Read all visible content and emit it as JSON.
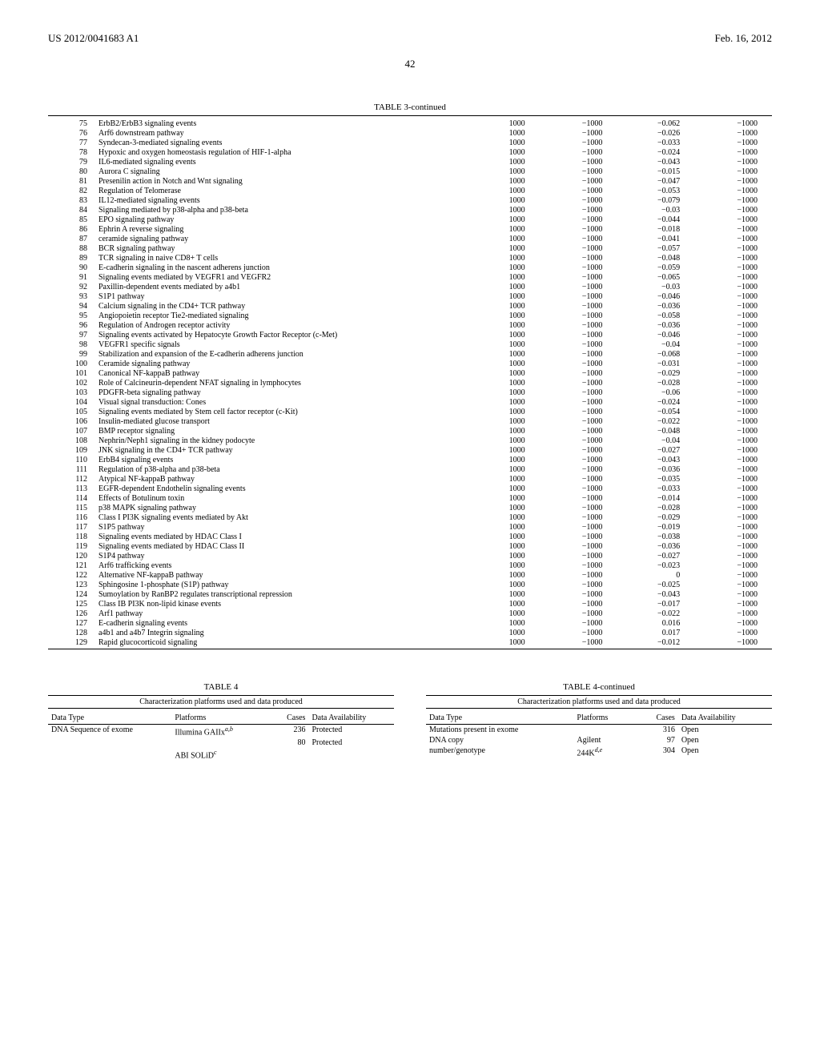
{
  "header": {
    "patent_id": "US 2012/0041683 A1",
    "date": "Feb. 16, 2012"
  },
  "page_number": "42",
  "table3": {
    "title": "TABLE 3-continued",
    "rows": [
      {
        "idx": "75",
        "name": "ErbB2/ErbB3 signaling events",
        "c1": "1000",
        "c2": "−1000",
        "c3": "−0.062",
        "c4": "−1000"
      },
      {
        "idx": "76",
        "name": "Arf6 downstream pathway",
        "c1": "1000",
        "c2": "−1000",
        "c3": "−0.026",
        "c4": "−1000"
      },
      {
        "idx": "77",
        "name": "Syndecan-3-mediated signaling events",
        "c1": "1000",
        "c2": "−1000",
        "c3": "−0.033",
        "c4": "−1000"
      },
      {
        "idx": "78",
        "name": "Hypoxic and oxygen homeostasis regulation of HIF-1-alpha",
        "c1": "1000",
        "c2": "−1000",
        "c3": "−0.024",
        "c4": "−1000"
      },
      {
        "idx": "79",
        "name": "IL6-mediated signaling events",
        "c1": "1000",
        "c2": "−1000",
        "c3": "−0.043",
        "c4": "−1000"
      },
      {
        "idx": "80",
        "name": "Aurora C signaling",
        "c1": "1000",
        "c2": "−1000",
        "c3": "−0.015",
        "c4": "−1000"
      },
      {
        "idx": "81",
        "name": "Presenilin action in Notch and Wnt signaling",
        "c1": "1000",
        "c2": "−1000",
        "c3": "−0.047",
        "c4": "−1000"
      },
      {
        "idx": "82",
        "name": "Regulation of Telomerase",
        "c1": "1000",
        "c2": "−1000",
        "c3": "−0.053",
        "c4": "−1000"
      },
      {
        "idx": "83",
        "name": "IL12-mediated signaling events",
        "c1": "1000",
        "c2": "−1000",
        "c3": "−0.079",
        "c4": "−1000"
      },
      {
        "idx": "84",
        "name": "Signaling mediated by p38-alpha and p38-beta",
        "c1": "1000",
        "c2": "−1000",
        "c3": "−0.03",
        "c4": "−1000"
      },
      {
        "idx": "85",
        "name": "EPO signaling pathway",
        "c1": "1000",
        "c2": "−1000",
        "c3": "−0.044",
        "c4": "−1000"
      },
      {
        "idx": "86",
        "name": "Ephrin A reverse signaling",
        "c1": "1000",
        "c2": "−1000",
        "c3": "−0.018",
        "c4": "−1000"
      },
      {
        "idx": "87",
        "name": "ceramide signaling pathway",
        "c1": "1000",
        "c2": "−1000",
        "c3": "−0.041",
        "c4": "−1000"
      },
      {
        "idx": "88",
        "name": "BCR signaling pathway",
        "c1": "1000",
        "c2": "−1000",
        "c3": "−0.057",
        "c4": "−1000"
      },
      {
        "idx": "89",
        "name": "TCR signaling in naive CD8+ T cells",
        "c1": "1000",
        "c2": "−1000",
        "c3": "−0.048",
        "c4": "−1000"
      },
      {
        "idx": "90",
        "name": "E-cadherin signaling in the nascent adherens junction",
        "c1": "1000",
        "c2": "−1000",
        "c3": "−0.059",
        "c4": "−1000"
      },
      {
        "idx": "91",
        "name": "Signaling events mediated by VEGFR1 and VEGFR2",
        "c1": "1000",
        "c2": "−1000",
        "c3": "−0.065",
        "c4": "−1000"
      },
      {
        "idx": "92",
        "name": "Paxillin-dependent events mediated by a4b1",
        "c1": "1000",
        "c2": "−1000",
        "c3": "−0.03",
        "c4": "−1000"
      },
      {
        "idx": "93",
        "name": "S1P1 pathway",
        "c1": "1000",
        "c2": "−1000",
        "c3": "−0.046",
        "c4": "−1000"
      },
      {
        "idx": "94",
        "name": "Calcium signaling in the CD4+ TCR pathway",
        "c1": "1000",
        "c2": "−1000",
        "c3": "−0.036",
        "c4": "−1000"
      },
      {
        "idx": "95",
        "name": "Angiopoietin receptor Tie2-mediated signaling",
        "c1": "1000",
        "c2": "−1000",
        "c3": "−0.058",
        "c4": "−1000"
      },
      {
        "idx": "96",
        "name": "Regulation of Androgen receptor activity",
        "c1": "1000",
        "c2": "−1000",
        "c3": "−0.036",
        "c4": "−1000"
      },
      {
        "idx": "97",
        "name": "Signaling events activated by Hepatocyte Growth Factor Receptor (c-Met)",
        "c1": "1000",
        "c2": "−1000",
        "c3": "−0.046",
        "c4": "−1000"
      },
      {
        "idx": "98",
        "name": "VEGFR1 specific signals",
        "c1": "1000",
        "c2": "−1000",
        "c3": "−0.04",
        "c4": "−1000"
      },
      {
        "idx": "99",
        "name": "Stabilization and expansion of the E-cadherin adherens junction",
        "c1": "1000",
        "c2": "−1000",
        "c3": "−0.068",
        "c4": "−1000"
      },
      {
        "idx": "100",
        "name": "Ceramide signaling pathway",
        "c1": "1000",
        "c2": "−1000",
        "c3": "−0.031",
        "c4": "−1000"
      },
      {
        "idx": "101",
        "name": "Canonical NF-kappaB pathway",
        "c1": "1000",
        "c2": "−1000",
        "c3": "−0.029",
        "c4": "−1000"
      },
      {
        "idx": "102",
        "name": "Role of Calcineurin-dependent NFAT signaling in lymphocytes",
        "c1": "1000",
        "c2": "−1000",
        "c3": "−0.028",
        "c4": "−1000"
      },
      {
        "idx": "103",
        "name": "PDGFR-beta signaling pathway",
        "c1": "1000",
        "c2": "−1000",
        "c3": "−0.06",
        "c4": "−1000"
      },
      {
        "idx": "104",
        "name": "Visual signal transduction: Cones",
        "c1": "1000",
        "c2": "−1000",
        "c3": "−0.024",
        "c4": "−1000"
      },
      {
        "idx": "105",
        "name": "Signaling events mediated by Stem cell factor receptor (c-Kit)",
        "c1": "1000",
        "c2": "−1000",
        "c3": "−0.054",
        "c4": "−1000"
      },
      {
        "idx": "106",
        "name": "Insulin-mediated glucose transport",
        "c1": "1000",
        "c2": "−1000",
        "c3": "−0.022",
        "c4": "−1000"
      },
      {
        "idx": "107",
        "name": "BMP receptor signaling",
        "c1": "1000",
        "c2": "−1000",
        "c3": "−0.048",
        "c4": "−1000"
      },
      {
        "idx": "108",
        "name": "Nephrin/Neph1 signaling in the kidney podocyte",
        "c1": "1000",
        "c2": "−1000",
        "c3": "−0.04",
        "c4": "−1000"
      },
      {
        "idx": "109",
        "name": "JNK signaling in the CD4+ TCR pathway",
        "c1": "1000",
        "c2": "−1000",
        "c3": "−0.027",
        "c4": "−1000"
      },
      {
        "idx": "110",
        "name": "ErbB4 signaling events",
        "c1": "1000",
        "c2": "−1000",
        "c3": "−0.043",
        "c4": "−1000"
      },
      {
        "idx": "111",
        "name": "Regulation of p38-alpha and p38-beta",
        "c1": "1000",
        "c2": "−1000",
        "c3": "−0.036",
        "c4": "−1000"
      },
      {
        "idx": "112",
        "name": "Atypical NF-kappaB pathway",
        "c1": "1000",
        "c2": "−1000",
        "c3": "−0.035",
        "c4": "−1000"
      },
      {
        "idx": "113",
        "name": "EGFR-dependent Endothelin signaling events",
        "c1": "1000",
        "c2": "−1000",
        "c3": "−0.033",
        "c4": "−1000"
      },
      {
        "idx": "114",
        "name": "Effects of Botulinum toxin",
        "c1": "1000",
        "c2": "−1000",
        "c3": "−0.014",
        "c4": "−1000"
      },
      {
        "idx": "115",
        "name": "p38 MAPK signaling pathway",
        "c1": "1000",
        "c2": "−1000",
        "c3": "−0.028",
        "c4": "−1000"
      },
      {
        "idx": "116",
        "name": "Class I PI3K signaling events mediated by Akt",
        "c1": "1000",
        "c2": "−1000",
        "c3": "−0.029",
        "c4": "−1000"
      },
      {
        "idx": "117",
        "name": "S1P5 pathway",
        "c1": "1000",
        "c2": "−1000",
        "c3": "−0.019",
        "c4": "−1000"
      },
      {
        "idx": "118",
        "name": "Signaling events mediated by HDAC Class I",
        "c1": "1000",
        "c2": "−1000",
        "c3": "−0.038",
        "c4": "−1000"
      },
      {
        "idx": "119",
        "name": "Signaling events mediated by HDAC Class II",
        "c1": "1000",
        "c2": "−1000",
        "c3": "−0.036",
        "c4": "−1000"
      },
      {
        "idx": "120",
        "name": "S1P4 pathway",
        "c1": "1000",
        "c2": "−1000",
        "c3": "−0.027",
        "c4": "−1000"
      },
      {
        "idx": "121",
        "name": "Arf6 trafficking events",
        "c1": "1000",
        "c2": "−1000",
        "c3": "−0.023",
        "c4": "−1000"
      },
      {
        "idx": "122",
        "name": "Alternative NF-kappaB pathway",
        "c1": "1000",
        "c2": "−1000",
        "c3": "0",
        "c4": "−1000"
      },
      {
        "idx": "123",
        "name": "Sphingosine 1-phosphate (S1P) pathway",
        "c1": "1000",
        "c2": "−1000",
        "c3": "−0.025",
        "c4": "−1000"
      },
      {
        "idx": "124",
        "name": "Sumoylation by RanBP2 regulates transcriptional repression",
        "c1": "1000",
        "c2": "−1000",
        "c3": "−0.043",
        "c4": "−1000"
      },
      {
        "idx": "125",
        "name": "Class IB PI3K non-lipid kinase events",
        "c1": "1000",
        "c2": "−1000",
        "c3": "−0.017",
        "c4": "−1000"
      },
      {
        "idx": "126",
        "name": "Arf1 pathway",
        "c1": "1000",
        "c2": "−1000",
        "c3": "−0.022",
        "c4": "−1000"
      },
      {
        "idx": "127",
        "name": "E-cadherin signaling events",
        "c1": "1000",
        "c2": "−1000",
        "c3": "0.016",
        "c4": "−1000"
      },
      {
        "idx": "128",
        "name": "a4b1 and a4b7 Integrin signaling",
        "c1": "1000",
        "c2": "−1000",
        "c3": "0.017",
        "c4": "−1000"
      },
      {
        "idx": "129",
        "name": "Rapid glucocorticoid signaling",
        "c1": "1000",
        "c2": "−1000",
        "c3": "−0.012",
        "c4": "−1000"
      }
    ]
  },
  "table4_left": {
    "title": "TABLE 4",
    "caption": "Characterization platforms used and data produced",
    "headers": {
      "dt": "Data Type",
      "plat": "Platforms",
      "cases": "Cases",
      "avail": "Data Availability"
    },
    "rows": [
      {
        "dt": "DNA Sequence of exome",
        "plat": "Illumina GAIIx",
        "sup": "a,b",
        "cases": "236",
        "avail": "Protected"
      },
      {
        "dt": "",
        "plat": "",
        "sup": "",
        "cases": "80",
        "avail": "Protected"
      },
      {
        "dt": "",
        "plat": "ABI SOLiD",
        "sup": "c",
        "cases": "",
        "avail": ""
      }
    ]
  },
  "table4_right": {
    "title": "TABLE 4-continued",
    "caption": "Characterization platforms used and data produced",
    "headers": {
      "dt": "Data Type",
      "plat": "Platforms",
      "cases": "Cases",
      "avail": "Data Availability"
    },
    "rows": [
      {
        "dt": "Mutations present in exome",
        "plat": "",
        "sup": "",
        "cases": "316",
        "avail": "Open"
      },
      {
        "dt": "DNA copy",
        "plat": "Agilent",
        "sup": "",
        "cases": "97",
        "avail": "Open"
      },
      {
        "dt": "number/genotype",
        "plat": "244K",
        "sup": "d,e",
        "cases": "304",
        "avail": "Open"
      }
    ]
  }
}
